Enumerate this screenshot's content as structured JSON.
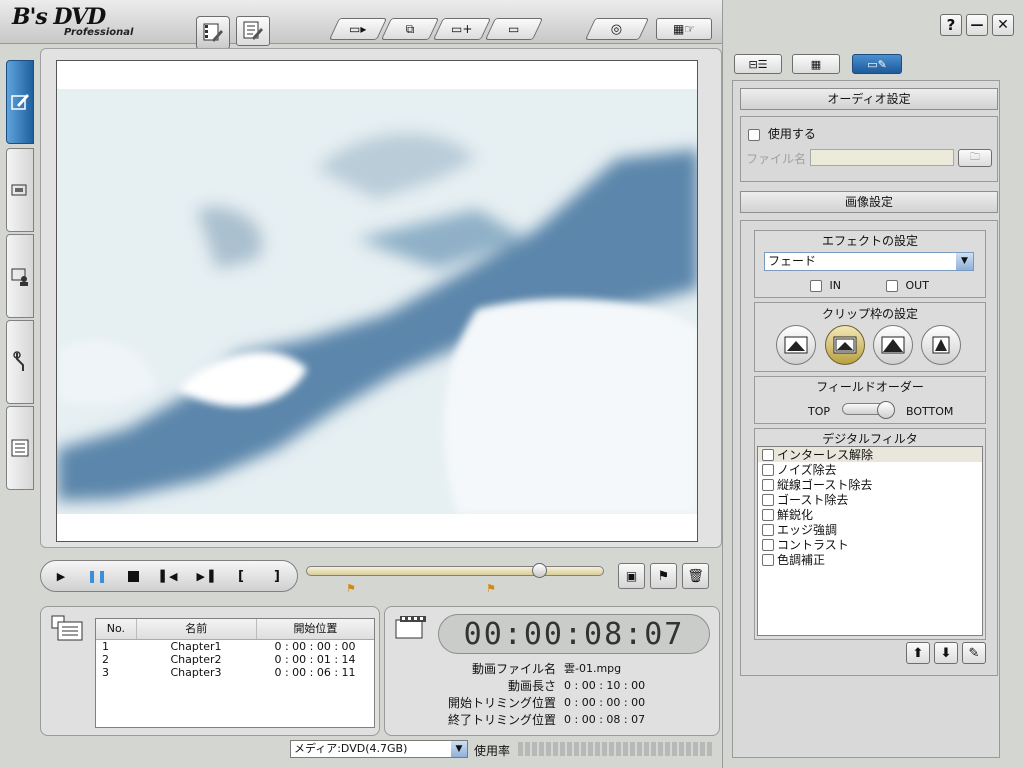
{
  "app": {
    "logo_main": "B's DVD",
    "logo_sub": "Professional"
  },
  "window_buttons": {
    "help": "?",
    "minimize": "—",
    "close": "✕"
  },
  "audio": {
    "header": "オーディオ設定",
    "use_label": "使用する",
    "file_label": "ファイル名",
    "file_value": ""
  },
  "image": {
    "header": "画像設定"
  },
  "effect": {
    "header": "エフェクトの設定",
    "selected": "フェード",
    "in_label": "IN",
    "out_label": "OUT"
  },
  "clip": {
    "header": "クリップ枠の設定"
  },
  "field_order": {
    "header": "フィールドオーダー",
    "top": "TOP",
    "bottom": "BOTTOM"
  },
  "digital_filter": {
    "header": "デジタルフィルタ",
    "items": [
      "インターレス解除",
      "ノイズ除去",
      "縦線ゴースト除去",
      "ゴースト除去",
      "鮮鋭化",
      "エッジ強調",
      "コントラスト",
      "色調補正"
    ]
  },
  "chapters": {
    "columns": [
      "No.",
      "名前",
      "開始位置"
    ],
    "rows": [
      {
        "no": "1",
        "name": "Chapter1",
        "start": "0 : 00 : 00 : 00"
      },
      {
        "no": "2",
        "name": "Chapter2",
        "start": "0 : 00 : 01 : 14"
      },
      {
        "no": "3",
        "name": "Chapter3",
        "start": "0 : 00 : 06 : 11"
      }
    ]
  },
  "timecode": "00:00:08:07",
  "info": {
    "filename_label": "動画ファイル名",
    "filename_value": "雲-01.mpg",
    "length_label": "動画長さ",
    "length_value": "0 : 00 : 10 : 00",
    "trim_start_label": "開始トリミング位置",
    "trim_start_value": "0 : 00 : 00 : 00",
    "trim_end_label": "終了トリミング位置",
    "trim_end_value": "0 : 00 : 08 : 07"
  },
  "status": {
    "media_select": "メディア:DVD(4.7GB)",
    "usage_label": "使用率"
  },
  "playback": {
    "position_fraction": 0.8
  },
  "colors": {
    "accent": "#3a7fc2",
    "sky": "#5b86ab",
    "timecode_bg": "#c8ccc8"
  }
}
